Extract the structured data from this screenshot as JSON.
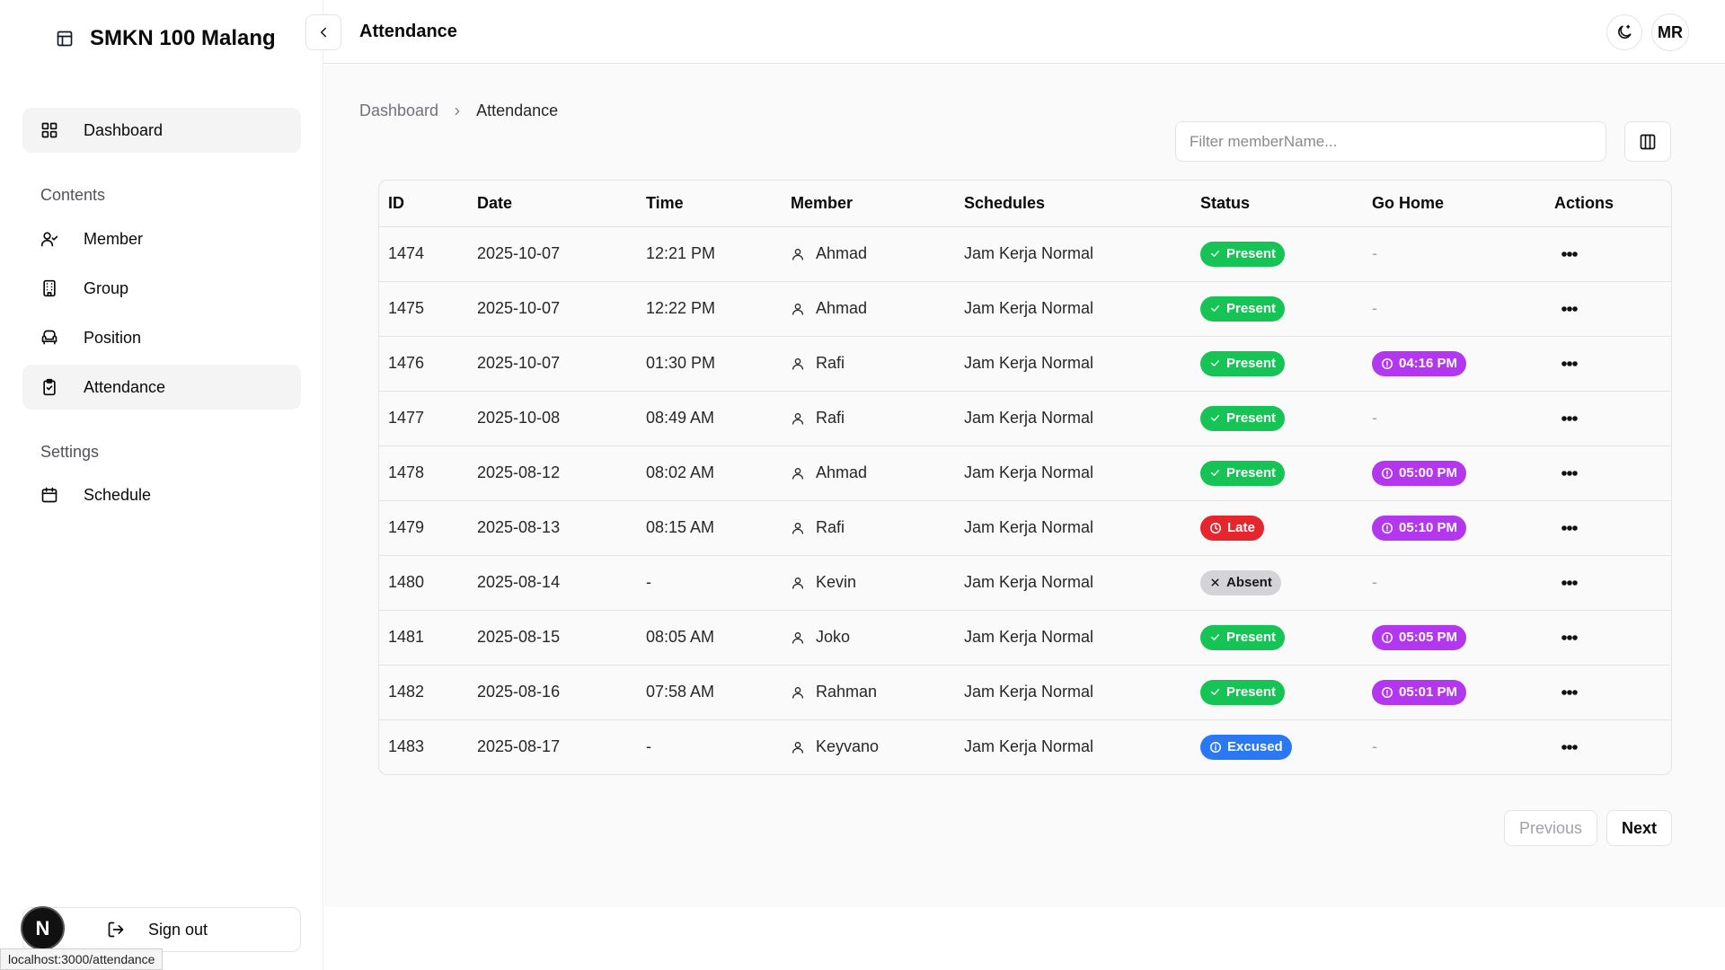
{
  "sidebar": {
    "brand": "SMKN 100 Malang",
    "nav": {
      "dashboard": "Dashboard",
      "contents_title": "Contents",
      "member": "Member",
      "group": "Group",
      "position": "Position",
      "attendance": "Attendance",
      "settings_title": "Settings",
      "schedule": "Schedule"
    },
    "signout": "Sign out",
    "logo_letter": "N"
  },
  "header": {
    "title": "Attendance",
    "avatar_initials": "MR"
  },
  "breadcrumb": {
    "home": "Dashboard",
    "current": "Attendance"
  },
  "filter": {
    "placeholder": "Filter memberName...",
    "value": ""
  },
  "table": {
    "headers": {
      "id": "ID",
      "date": "Date",
      "time": "Time",
      "member": "Member",
      "schedules": "Schedules",
      "status": "Status",
      "go_home": "Go Home",
      "actions": "Actions"
    },
    "rows": [
      {
        "id": "1474",
        "date": "2025-10-07",
        "time": "12:21 PM",
        "member": "Ahmad",
        "schedule": "Jam Kerja Normal",
        "status": "Present",
        "go_home": "-"
      },
      {
        "id": "1475",
        "date": "2025-10-07",
        "time": "12:22 PM",
        "member": "Ahmad",
        "schedule": "Jam Kerja Normal",
        "status": "Present",
        "go_home": "-"
      },
      {
        "id": "1476",
        "date": "2025-10-07",
        "time": "01:30 PM",
        "member": "Rafi",
        "schedule": "Jam Kerja Normal",
        "status": "Present",
        "go_home": "04:16 PM"
      },
      {
        "id": "1477",
        "date": "2025-10-08",
        "time": "08:49 AM",
        "member": "Rafi",
        "schedule": "Jam Kerja Normal",
        "status": "Present",
        "go_home": "-"
      },
      {
        "id": "1478",
        "date": "2025-08-12",
        "time": "08:02 AM",
        "member": "Ahmad",
        "schedule": "Jam Kerja Normal",
        "status": "Present",
        "go_home": "05:00 PM"
      },
      {
        "id": "1479",
        "date": "2025-08-13",
        "time": "08:15 AM",
        "member": "Rafi",
        "schedule": "Jam Kerja Normal",
        "status": "Late",
        "go_home": "05:10 PM"
      },
      {
        "id": "1480",
        "date": "2025-08-14",
        "time": "-",
        "member": "Kevin",
        "schedule": "Jam Kerja Normal",
        "status": "Absent",
        "go_home": "-"
      },
      {
        "id": "1481",
        "date": "2025-08-15",
        "time": "08:05 AM",
        "member": "Joko",
        "schedule": "Jam Kerja Normal",
        "status": "Present",
        "go_home": "05:05 PM"
      },
      {
        "id": "1482",
        "date": "2025-08-16",
        "time": "07:58 AM",
        "member": "Rahman",
        "schedule": "Jam Kerja Normal",
        "status": "Present",
        "go_home": "05:01 PM"
      },
      {
        "id": "1483",
        "date": "2025-08-17",
        "time": "-",
        "member": "Keyvano",
        "schedule": "Jam Kerja Normal",
        "status": "Excused",
        "go_home": "-"
      }
    ]
  },
  "pagination": {
    "previous": "Previous",
    "next": "Next"
  },
  "statusbar": {
    "url": "localhost:3000/attendance"
  },
  "colors": {
    "present": "#16c455",
    "late": "#e5262d",
    "absent": "#d4d4d8",
    "excused": "#2b78f6",
    "go_home": "#b437f0"
  }
}
